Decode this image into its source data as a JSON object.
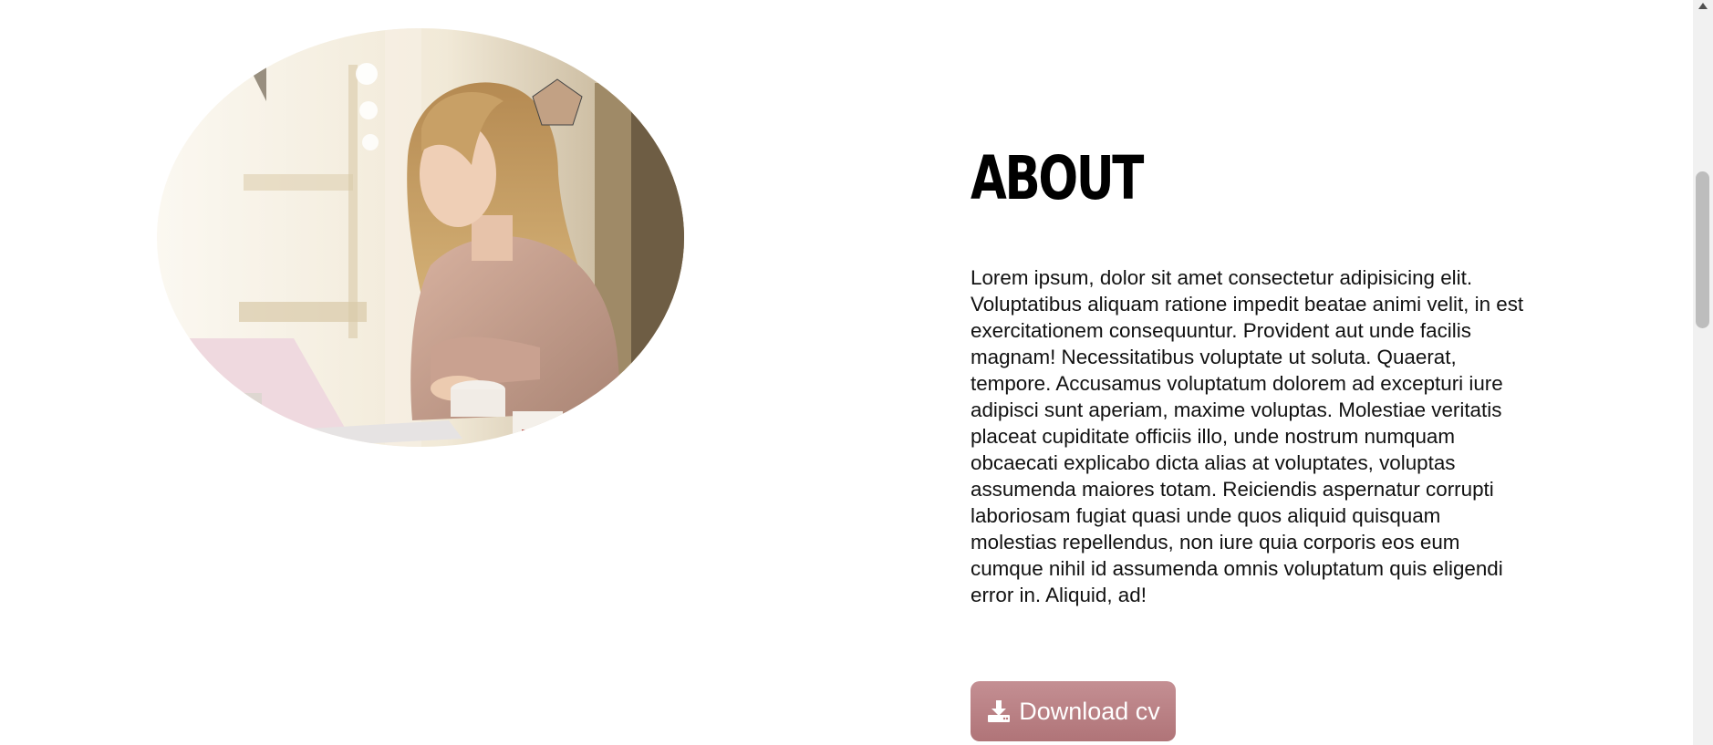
{
  "about": {
    "title": "About",
    "body": "Lorem ipsum, dolor sit amet consectetur adipisicing elit. Voluptatibus aliquam ratione impedit beatae animi velit, in est exercitationem consequuntur. Provident aut unde facilis magnam! Necessitatibus voluptate ut soluta. Quaerat, tempore. Accusamus voluptatum dolorem ad excepturi iure adipisci sunt aperiam, maxime voluptas. Molestiae veritatis placeat cupiditate officiis illo, unde nostrum numquam obcaecati explicabo dicta alias at voluptates, voluptas assumenda maiores totam. Reiciendis aspernatur corrupti laboriosam fugiat quasi unde quos aliquid quisquam molestias repellendus, non iure quia corporis eos eum cumque nihil id assumenda omnis voluptatum quis eligendi error in. Aliquid, ad!",
    "download_label": "Download cv",
    "download_icon": "download-icon"
  },
  "colors": {
    "button": "#b9797d",
    "pentagon": "#c2a184"
  }
}
